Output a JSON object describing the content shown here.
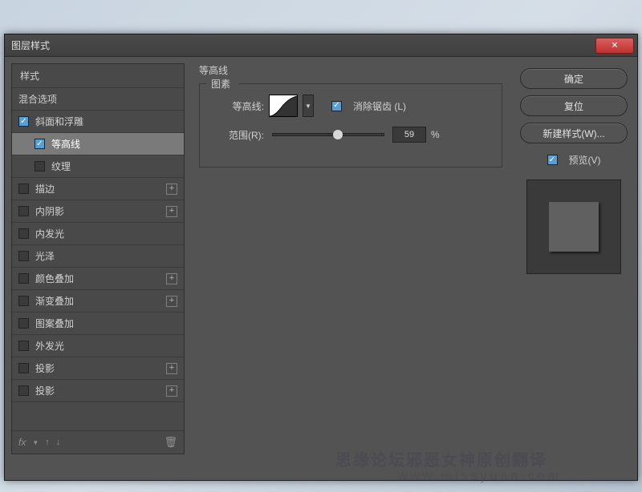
{
  "window": {
    "title": "图层样式"
  },
  "sidebar": {
    "header": "样式",
    "blending": "混合选项",
    "items": [
      {
        "label": "斜面和浮雕",
        "checked": true,
        "plus": false,
        "indent": false,
        "selected": false
      },
      {
        "label": "等高线",
        "checked": true,
        "plus": false,
        "indent": true,
        "selected": true
      },
      {
        "label": "纹理",
        "checked": false,
        "plus": false,
        "indent": true,
        "selected": false
      },
      {
        "label": "描边",
        "checked": false,
        "plus": true,
        "indent": false,
        "selected": false
      },
      {
        "label": "内阴影",
        "checked": false,
        "plus": true,
        "indent": false,
        "selected": false
      },
      {
        "label": "内发光",
        "checked": false,
        "plus": false,
        "indent": false,
        "selected": false
      },
      {
        "label": "光泽",
        "checked": false,
        "plus": false,
        "indent": false,
        "selected": false
      },
      {
        "label": "颜色叠加",
        "checked": false,
        "plus": true,
        "indent": false,
        "selected": false
      },
      {
        "label": "渐变叠加",
        "checked": false,
        "plus": true,
        "indent": false,
        "selected": false
      },
      {
        "label": "图案叠加",
        "checked": false,
        "plus": false,
        "indent": false,
        "selected": false
      },
      {
        "label": "外发光",
        "checked": false,
        "plus": false,
        "indent": false,
        "selected": false
      },
      {
        "label": "投影",
        "checked": false,
        "plus": true,
        "indent": false,
        "selected": false
      },
      {
        "label": "投影",
        "checked": false,
        "plus": true,
        "indent": false,
        "selected": false
      }
    ],
    "footer_fx": "fx"
  },
  "main": {
    "panel_title": "等高线",
    "fieldset_label": "图素",
    "contour_label": "等高线:",
    "antialias_label": "消除锯齿 (L)",
    "antialias_checked": true,
    "range_label": "范围(R):",
    "range_value": "59",
    "range_unit": "%",
    "range_percent": 59
  },
  "buttons": {
    "ok": "确定",
    "reset": "复位",
    "new_style": "新建样式(W)...",
    "preview": "预览(V)",
    "preview_checked": true
  },
  "watermark": {
    "line1": "思缘论坛邪恶女神原创翻译",
    "line2": "www.missyuan.com"
  }
}
